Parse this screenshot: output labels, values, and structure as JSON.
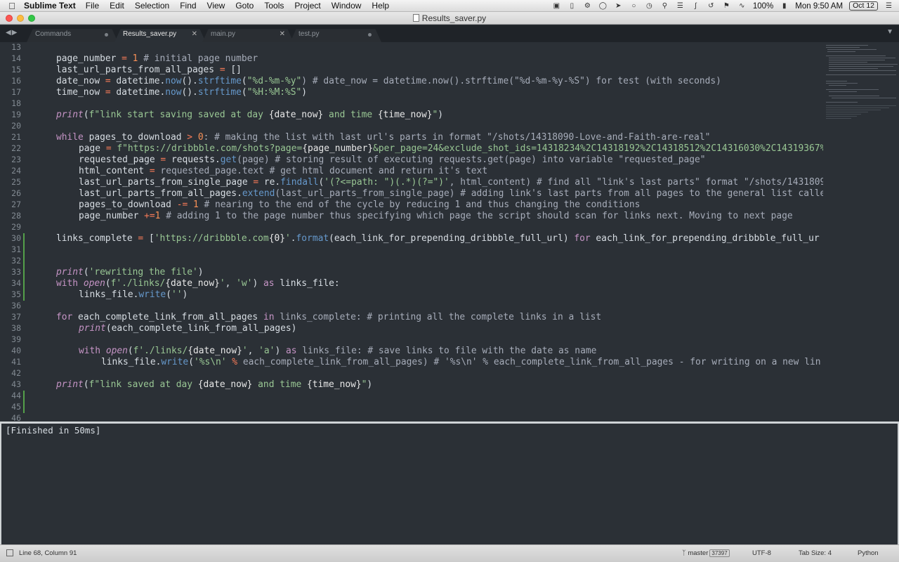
{
  "menubar": {
    "app_name": "Sublime Text",
    "menus": [
      "File",
      "Edit",
      "Selection",
      "Find",
      "View",
      "Goto",
      "Tools",
      "Project",
      "Window",
      "Help"
    ],
    "battery": "100%",
    "clock": "Mon 9:50 AM",
    "date_badge": "Oct 12",
    "status_icons": [
      "dropbox-icon",
      "phone-icon",
      "settings-icon",
      "timer-icon",
      "send-icon",
      "ring-icon",
      "clock-icon",
      "pin-icon",
      "plug-icon",
      "bluetooth-icon",
      "time-machine-icon",
      "flag-icon",
      "wifi-icon",
      "battery-icon",
      "list-icon"
    ]
  },
  "window": {
    "title": "Results_saver.py"
  },
  "tabs": [
    {
      "label": "Commands",
      "state": "dirty"
    },
    {
      "label": "Results_saver.py",
      "state": "active"
    },
    {
      "label": "main.py",
      "state": "close"
    },
    {
      "label": "test.py",
      "state": "dirty"
    }
  ],
  "editor": {
    "line_numbers": [
      "13",
      "14",
      "15",
      "16",
      "17",
      "18",
      "19",
      "20",
      "21",
      "22",
      "23",
      "24",
      "25",
      "26",
      "27",
      "28",
      "29",
      "30",
      "31",
      "32",
      "33",
      "34",
      "35",
      "36",
      "37",
      "38",
      "39",
      "40",
      "41",
      "42",
      "43",
      "44",
      "45",
      "46"
    ],
    "code": {
      "l14": {
        "a": "page_number ",
        "b": "=",
        "c": " ",
        "d": "1",
        "e": " # initial page number"
      },
      "l15": {
        "a": "last_url_parts_from_all_pages ",
        "b": "=",
        "c": " []"
      },
      "l16": {
        "a": "date_now ",
        "b": "=",
        "c": " datetime.",
        "d": "now",
        "e": "().",
        "f": "strftime",
        "g": "(",
        "h": "\"%d-%m-%y\"",
        "i": ") # date_now = datetime.now().strftime(\"%d-%m-%y-%S\") for test (with seconds)"
      },
      "l17": {
        "a": "time_now ",
        "b": "=",
        "c": " datetime.",
        "d": "now",
        "e": "().",
        "f": "strftime",
        "g": "(",
        "h": "\"%H:%M:%S\"",
        "i": ")"
      },
      "l19": {
        "a": "print",
        "b": "(",
        "c": "f\"link start saving saved at day ",
        "d": "{date_now}",
        "e": " and time ",
        "f": "{time_now}",
        "g": "\"",
        "h": ")"
      },
      "l21": {
        "a": "while",
        "b": " pages_to_download ",
        "c": ">",
        "d": " ",
        "e": "0",
        "f": ": # making the list with last url's parts in format \"/shots/14318090-Love-and-Faith-are-real\""
      },
      "l22": {
        "a": "page ",
        "b": "=",
        "c": " ",
        "d": "f\"https://dribbble.com/shots?page=",
        "e": "{page_number}",
        "f": "&per_page=24&exclude_shot_ids=14318234%2C14318192%2C14318512%2C14316030%2C14319367%"
      },
      "l23": {
        "a": "requested_page ",
        "b": "=",
        "c": " requests.",
        "d": "get",
        "e": "(page) # storing result of executing requests.get(page) into variable \"requested_page\""
      },
      "l24": {
        "a": "html_content ",
        "b": "=",
        "c": " requested_page.text # get html document and return it's text"
      },
      "l25": {
        "a": "last_url_parts_from_single_page ",
        "b": "=",
        "c": " re.",
        "d": "findall",
        "e": "(",
        "f": "'(?<=path: \")(.*)(?=\")'",
        "g": ", html_content) # find all \"link's last parts\" format \"/shots/1431809"
      },
      "l26": {
        "a": "last_url_parts_from_all_pages.",
        "b": "extend",
        "c": "(last_url_parts_from_single_page) # adding link's last parts from all pages to the general list calle"
      },
      "l27": {
        "a": "pages_to_download ",
        "b": "-=",
        "c": " ",
        "d": "1",
        "e": " # nearing to the end of the cycle by reducing 1 and thus changing the conditions"
      },
      "l28": {
        "a": "page_number ",
        "b": "+=",
        "c": "1",
        "d": " # adding 1 to the page number thus specifying which page the script should scan for links next. Moving to next page"
      },
      "l30": {
        "a": "links_complete ",
        "b": "=",
        "c": " [",
        "d": "'https://dribbble.com",
        "e": "{0}",
        "f": "'",
        "g": ".",
        "h": "format",
        "i": "(each_link_for_prepending_dribbble_full_url) ",
        "j": "for",
        "k": " each_link_for_prepending_dribbble_full_ur"
      },
      "l33": {
        "a": "print",
        "b": "(",
        "c": "'rewriting the file'",
        "d": ")"
      },
      "l34": {
        "a": "with",
        "b": " ",
        "c": "open",
        "d": "(",
        "e": "f'./links/",
        "f": "{date_now}",
        "g": "'",
        "h": ", ",
        "i": "'w'",
        "j": ") ",
        "k": "as",
        "l": " links_file:"
      },
      "l35": {
        "a": "links_file.",
        "b": "write",
        "c": "(",
        "d": "''",
        "e": ")"
      },
      "l37": {
        "a": "for",
        "b": " each_complete_link_from_all_pages ",
        "c": "in",
        "d": " links_complete: # printing all the complete links in a list"
      },
      "l38": {
        "a": "print",
        "b": "(each_complete_link_from_all_pages)"
      },
      "l40": {
        "a": "with",
        "b": " ",
        "c": "open",
        "d": "(",
        "e": "f'./links/",
        "f": "{date_now}",
        "g": "'",
        "h": ", ",
        "i": "'a'",
        "j": ") ",
        "k": "as",
        "l": " links_file: # save links to file with the date as name"
      },
      "l41": {
        "a": "links_file.",
        "b": "write",
        "c": "(",
        "d": "'%s\\n'",
        "e": " ",
        "f": "%",
        "g": " each_complete_link_from_all_pages) # '%s\\n' % each_complete_link_from_all_pages - for writing on a new lin"
      },
      "l43": {
        "a": "print",
        "b": "(",
        "c": "f\"link saved at day ",
        "d": "{date_now}",
        "e": " and time ",
        "f": "{time_now}",
        "g": "\"",
        "h": ")"
      }
    }
  },
  "output": {
    "text": "[Finished in 50ms]"
  },
  "statusbar": {
    "cursor": "Line 68, Column 91",
    "branch": "master",
    "branch_count": "37397",
    "encoding": "UTF-8",
    "tab_size": "Tab Size: 4",
    "syntax": "Python"
  },
  "colors": {
    "editor_bg": "#2b3036",
    "keyword": "#c594c5",
    "function": "#6699cc",
    "string": "#99c794",
    "number": "#f99157",
    "modified_marker": "#54a04a"
  }
}
